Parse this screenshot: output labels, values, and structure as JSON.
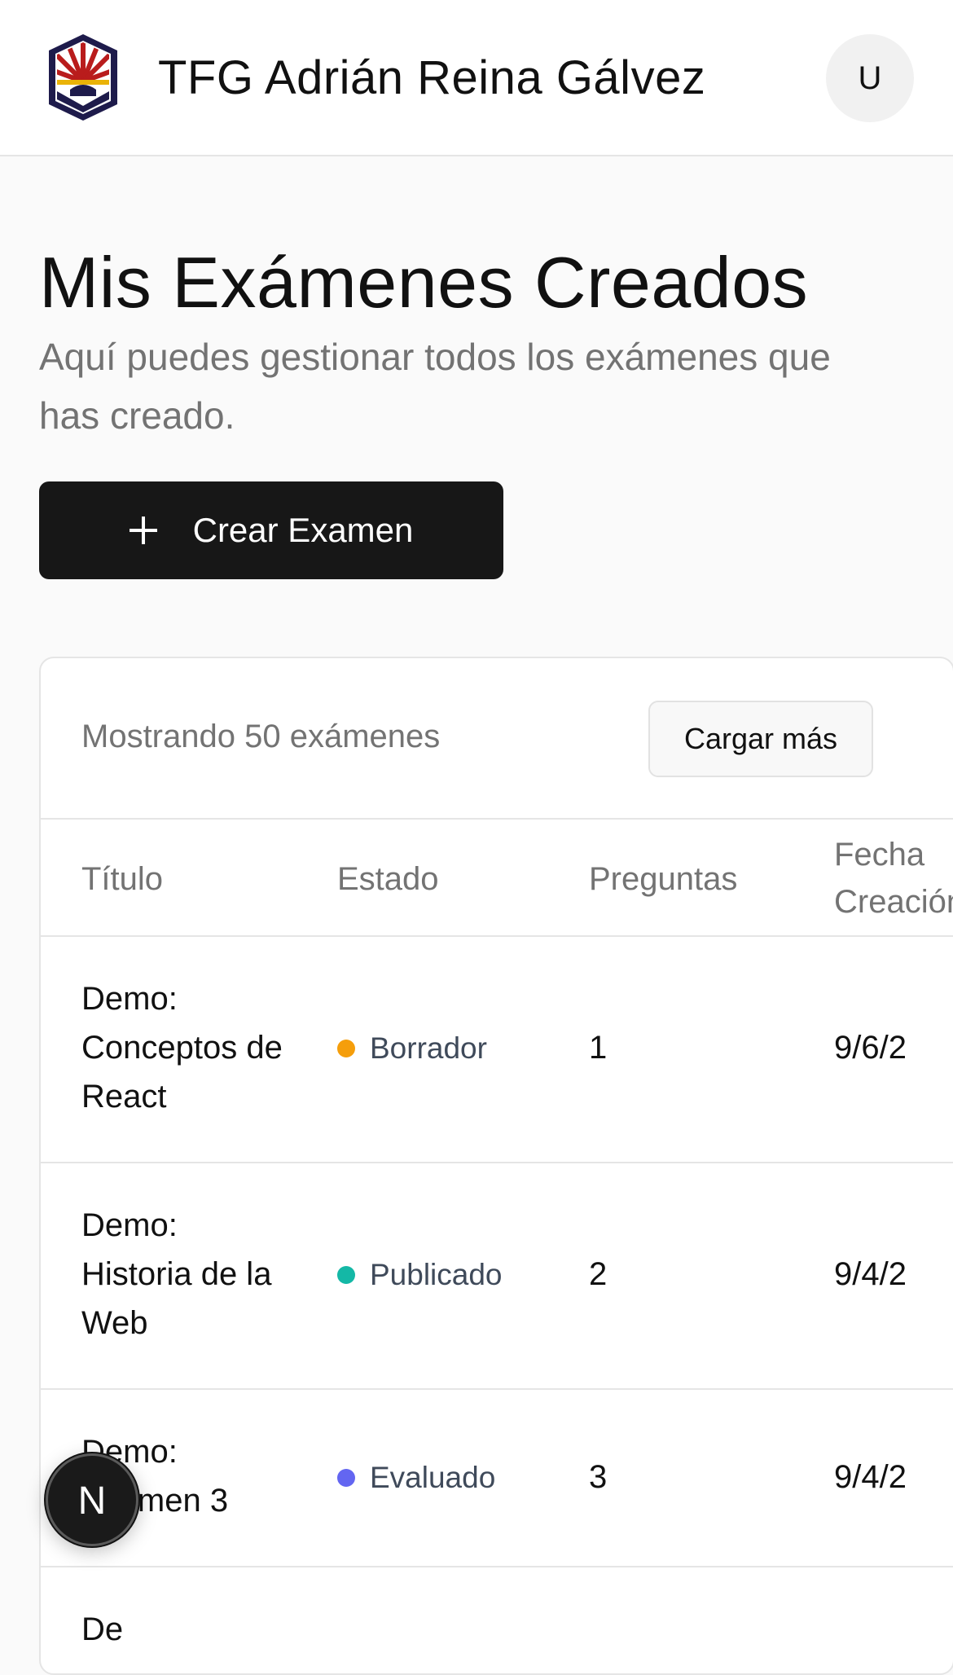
{
  "header": {
    "app_title": "TFG Adrián Reina Gálvez",
    "avatar_initial": "U"
  },
  "page": {
    "title": "Mis Exámenes Creados",
    "subtitle": "Aquí puedes gestionar todos los exámenes que has creado.",
    "create_button_label": "Crear Examen",
    "create_button_icon": "plus-icon"
  },
  "list": {
    "showing_text": "Mostrando 50 exámenes",
    "load_more_label": "Cargar más",
    "columns": [
      "Título",
      "Estado",
      "Preguntas",
      "Fecha\nCreación"
    ],
    "rows": [
      {
        "title": "Demo: Conceptos de React",
        "status": "Borrador",
        "status_color": "#f59e0b",
        "questions": "1",
        "date": "9/6/2"
      },
      {
        "title": "Demo: Historia de la Web",
        "status": "Publicado",
        "status_color": "#14b8a6",
        "questions": "2",
        "date": "9/4/2"
      },
      {
        "title": "Demo: Examen 3",
        "status": "Evaluado",
        "status_color": "#6366f1",
        "questions": "3",
        "date": "9/4/2"
      },
      {
        "title": "De",
        "status": "",
        "status_color": "",
        "questions": "",
        "date": ""
      }
    ]
  },
  "colors": {
    "primary_button": "#171717",
    "background": "#fafafa",
    "muted_text": "#737373"
  },
  "dev_indicator": {
    "letter": "N",
    "icon": "nextjs-icon"
  }
}
